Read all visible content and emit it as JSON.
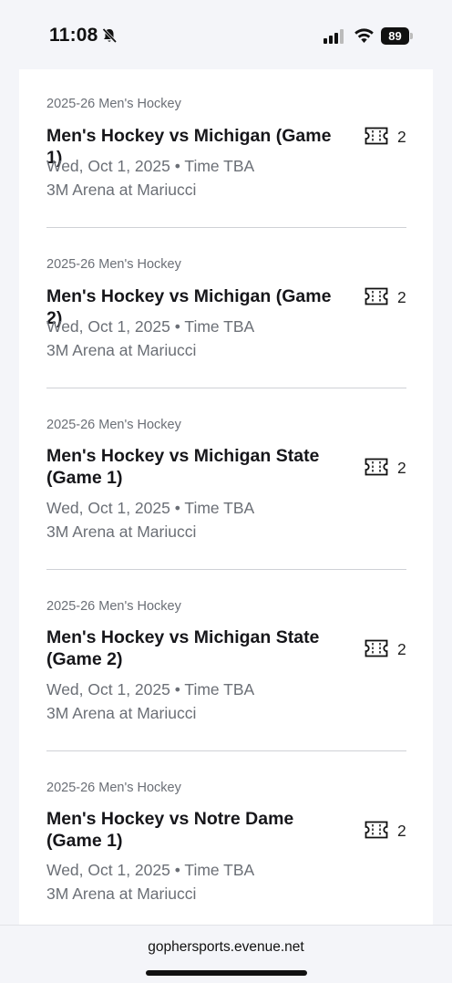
{
  "status_bar": {
    "time": "11:08",
    "battery": "89"
  },
  "events": [
    {
      "season": "2025-26 Men's Hockey",
      "title": "Men's Hockey vs Michigan (Game 1)",
      "date": "Wed, Oct 1, 2025 • Time TBA",
      "venue": "3M Arena at Mariucci",
      "tickets": "2"
    },
    {
      "season": "2025-26 Men's Hockey",
      "title": "Men's Hockey vs Michigan (Game 2)",
      "date": "Wed, Oct 1, 2025 • Time TBA",
      "venue": "3M Arena at Mariucci",
      "tickets": "2"
    },
    {
      "season": "2025-26 Men's Hockey",
      "title": "Men's Hockey vs Michigan State (Game 1)",
      "date": "Wed, Oct 1, 2025 • Time TBA",
      "venue": "3M Arena at Mariucci",
      "tickets": "2"
    },
    {
      "season": "2025-26 Men's Hockey",
      "title": "Men's Hockey vs Michigan State (Game 2)",
      "date": "Wed, Oct 1, 2025 • Time TBA",
      "venue": "3M Arena at Mariucci",
      "tickets": "2"
    },
    {
      "season": "2025-26 Men's Hockey",
      "title": "Men's Hockey vs Notre Dame (Game 1)",
      "date": "Wed, Oct 1, 2025 • Time TBA",
      "venue": "3M Arena at Mariucci",
      "tickets": "2"
    }
  ],
  "browser": {
    "url": "gophersports.evenue.net"
  },
  "icons": {
    "ticket": "ticket-icon",
    "bell": "bell-slash-icon",
    "signal": "cellular-signal-icon",
    "wifi": "wifi-icon"
  }
}
